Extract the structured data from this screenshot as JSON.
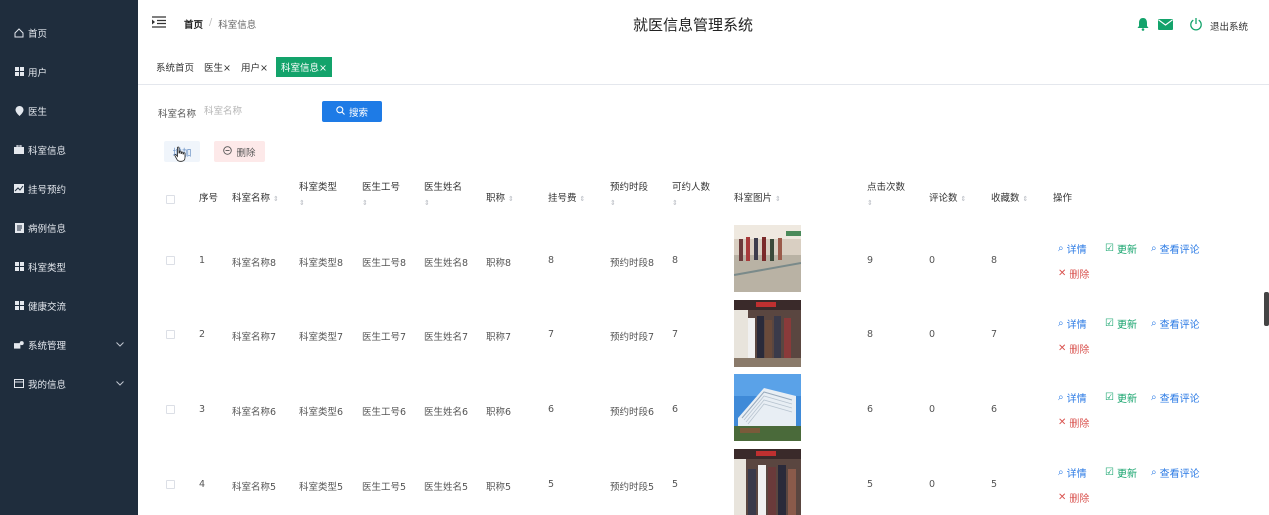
{
  "sidebar": {
    "items": [
      {
        "label": "首页",
        "icon": "home-icon"
      },
      {
        "label": "用户",
        "icon": "grid-icon"
      },
      {
        "label": "医生",
        "icon": "pin-icon"
      },
      {
        "label": "科室信息",
        "icon": "briefcase-icon"
      },
      {
        "label": "挂号预约",
        "icon": "chart-icon"
      },
      {
        "label": "病例信息",
        "icon": "doc-icon"
      },
      {
        "label": "科室类型",
        "icon": "grid-icon"
      },
      {
        "label": "健康交流",
        "icon": "grid-icon"
      },
      {
        "label": "系统管理",
        "icon": "settings-icon",
        "expandable": true
      },
      {
        "label": "我的信息",
        "icon": "card-icon",
        "expandable": true
      }
    ]
  },
  "header": {
    "breadcrumb": {
      "home": "首页",
      "separator": "/",
      "current": "科室信息"
    },
    "title": "就医信息管理系统",
    "logout": "退出系统"
  },
  "tabs": [
    {
      "label": "系统首页",
      "closable": false,
      "active": false
    },
    {
      "label": "医生",
      "closable": true,
      "active": false
    },
    {
      "label": "用户",
      "closable": true,
      "active": false
    },
    {
      "label": "科室信息",
      "closable": true,
      "active": true
    }
  ],
  "close_glyph": "×",
  "search": {
    "label": "科室名称",
    "placeholder": "科室名称",
    "button": "搜索"
  },
  "actions": {
    "add": "增加",
    "delete": "删除"
  },
  "table": {
    "headers": [
      "序号",
      "科室名称",
      "科室类型",
      "医生工号",
      "医生姓名",
      "职称",
      "挂号费",
      "预约时段",
      "可约人数",
      "科室图片",
      "点击次数",
      "评论数",
      "收藏数",
      "操作"
    ],
    "rows": [
      {
        "no": "1",
        "name": "科室名称8",
        "type": "科室类型8",
        "doc_id": "医生工号8",
        "doc_name": "医生姓名8",
        "title": "职称8",
        "fee": "8",
        "slot": "预约时段8",
        "capacity": "8",
        "clicks": "9",
        "comments": "0",
        "favs": "8"
      },
      {
        "no": "2",
        "name": "科室名称7",
        "type": "科室类型7",
        "doc_id": "医生工号7",
        "doc_name": "医生姓名7",
        "title": "职称7",
        "fee": "7",
        "slot": "预约时段7",
        "capacity": "7",
        "clicks": "8",
        "comments": "0",
        "favs": "7"
      },
      {
        "no": "3",
        "name": "科室名称6",
        "type": "科室类型6",
        "doc_id": "医生工号6",
        "doc_name": "医生姓名6",
        "title": "职称6",
        "fee": "6",
        "slot": "预约时段6",
        "capacity": "6",
        "clicks": "6",
        "comments": "0",
        "favs": "6"
      },
      {
        "no": "4",
        "name": "科室名称5",
        "type": "科室类型5",
        "doc_id": "医生工号5",
        "doc_name": "医生姓名5",
        "title": "职称5",
        "fee": "5",
        "slot": "预约时段5",
        "capacity": "5",
        "clicks": "5",
        "comments": "0",
        "favs": "5"
      }
    ],
    "ops": {
      "detail": "详情",
      "update": "更新",
      "review": "查看评论",
      "remove": "删除"
    }
  },
  "colors": {
    "sidebar_bg": "#1f2d3d",
    "active_tab": "#13a36b",
    "primary": "#1e7be6",
    "danger": "#d9534f",
    "bell": "#13a36b"
  }
}
